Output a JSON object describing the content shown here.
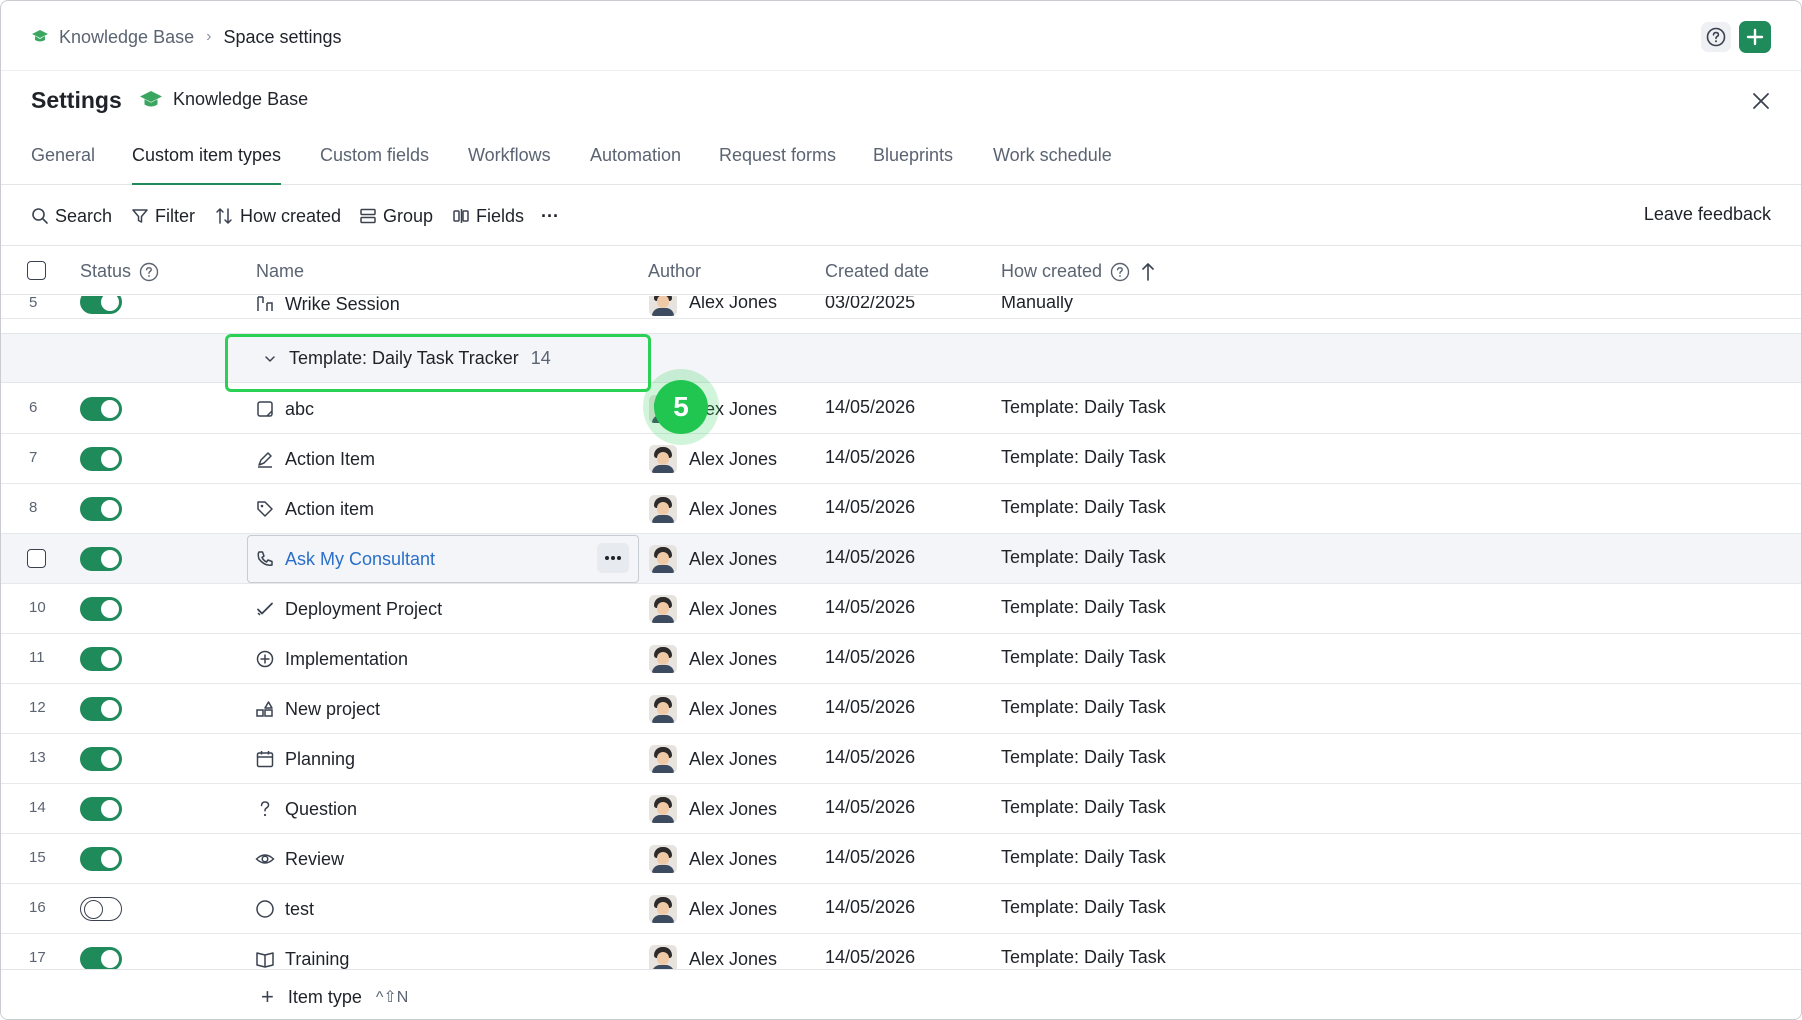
{
  "breadcrumb": {
    "space": "Knowledge Base",
    "separator": "›",
    "current": "Space settings"
  },
  "header": {
    "title": "Settings",
    "space_name": "Knowledge Base"
  },
  "tabs": [
    {
      "label": "General",
      "active": false
    },
    {
      "label": "Custom item types",
      "active": true
    },
    {
      "label": "Custom fields",
      "active": false
    },
    {
      "label": "Workflows",
      "active": false
    },
    {
      "label": "Automation",
      "active": false
    },
    {
      "label": "Request forms",
      "active": false
    },
    {
      "label": "Blueprints",
      "active": false
    },
    {
      "label": "Work schedule",
      "active": false
    }
  ],
  "toolbar": {
    "search": "Search",
    "filter": "Filter",
    "how_created": "How created",
    "group": "Group",
    "fields": "Fields",
    "more": "···",
    "feedback": "Leave feedback"
  },
  "columns": {
    "status": "Status",
    "name": "Name",
    "author": "Author",
    "created": "Created date",
    "how": "How created"
  },
  "partial_row": {
    "num": "5",
    "name": "Wrike Session",
    "author": "Alex Jones",
    "date": "03/02/2025",
    "how": "Manually"
  },
  "group": {
    "label": "Template: Daily Task Tracker",
    "count": "14"
  },
  "rows": [
    {
      "num": "6",
      "name": "abc",
      "icon": "note-icon",
      "on": true,
      "author": "Alex Jones",
      "date": "14/05/2026",
      "how": "Template: Daily Task"
    },
    {
      "num": "7",
      "name": "Action Item",
      "icon": "pen-icon",
      "on": true,
      "author": "Alex Jones",
      "date": "14/05/2026",
      "how": "Template: Daily Task"
    },
    {
      "num": "8",
      "name": "Action item",
      "icon": "tag-icon",
      "on": true,
      "author": "Alex Jones",
      "date": "14/05/2026",
      "how": "Template: Daily Task"
    },
    {
      "num": "",
      "name": "Ask My Consultant",
      "icon": "phone-icon",
      "on": true,
      "author": "Alex Jones",
      "date": "14/05/2026",
      "how": "Template: Daily Task"
    },
    {
      "num": "10",
      "name": "Deployment Project",
      "icon": "check-icon",
      "on": true,
      "author": "Alex Jones",
      "date": "14/05/2026",
      "how": "Template: Daily Task"
    },
    {
      "num": "11",
      "name": "Implementation",
      "icon": "plus-circle-icon",
      "on": true,
      "author": "Alex Jones",
      "date": "14/05/2026",
      "how": "Template: Daily Task"
    },
    {
      "num": "12",
      "name": "New project",
      "icon": "shapes-icon",
      "on": true,
      "author": "Alex Jones",
      "date": "14/05/2026",
      "how": "Template: Daily Task"
    },
    {
      "num": "13",
      "name": "Planning",
      "icon": "calendar-icon",
      "on": true,
      "author": "Alex Jones",
      "date": "14/05/2026",
      "how": "Template: Daily Task"
    },
    {
      "num": "14",
      "name": "Question",
      "icon": "question-icon",
      "on": true,
      "author": "Alex Jones",
      "date": "14/05/2026",
      "how": "Template: Daily Task"
    },
    {
      "num": "15",
      "name": "Review",
      "icon": "eye-icon",
      "on": true,
      "author": "Alex Jones",
      "date": "14/05/2026",
      "how": "Template: Daily Task"
    },
    {
      "num": "16",
      "name": "test",
      "icon": "circle-icon",
      "on": false,
      "author": "Alex Jones",
      "date": "14/05/2026",
      "how": "Template: Daily Task"
    },
    {
      "num": "17",
      "name": "Training",
      "icon": "book-icon",
      "on": true,
      "author": "Alex Jones",
      "date": "14/05/2026",
      "how": "Template: Daily Task"
    }
  ],
  "step_marker": "5",
  "footer": {
    "add_label": "Item type",
    "shortcut": "^⇧N"
  },
  "colors": {
    "accent": "#1f8a5a",
    "link": "#2a6fc9",
    "highlight": "#2bd155"
  }
}
